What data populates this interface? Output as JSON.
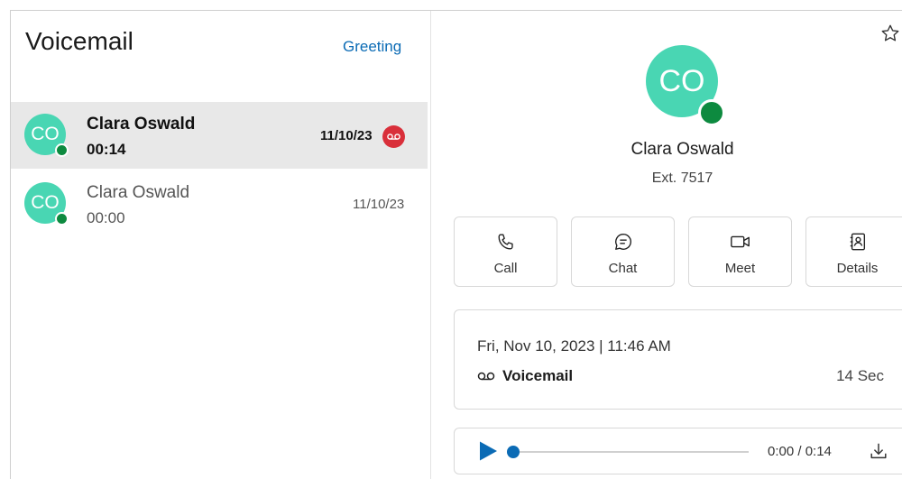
{
  "left": {
    "title": "Voicemail",
    "greeting_label": "Greeting",
    "items": [
      {
        "initials": "CO",
        "name": "Clara Oswald",
        "duration": "00:14",
        "date": "11/10/23",
        "unread": true
      },
      {
        "initials": "CO",
        "name": "Clara Oswald",
        "duration": "00:00",
        "date": "11/10/23",
        "unread": false
      }
    ]
  },
  "contact": {
    "initials": "CO",
    "name": "Clara Oswald",
    "extension": "Ext. 7517",
    "presence": "available"
  },
  "actions": [
    {
      "label": "Call",
      "icon": "phone-icon"
    },
    {
      "label": "Chat",
      "icon": "chat-icon"
    },
    {
      "label": "Meet",
      "icon": "video-icon"
    },
    {
      "label": "Details",
      "icon": "contact-card-icon"
    }
  ],
  "details": {
    "datetime": "Fri, Nov 10, 2023 | 11:46 AM",
    "type_label": "Voicemail",
    "duration_label": "14 Sec"
  },
  "player": {
    "time": "0:00 / 0:14",
    "progress": 0
  },
  "colors": {
    "avatar": "#49d6b3",
    "presence": "#0d8a3f",
    "accent": "#0b6bb5",
    "badge": "#d92f3a",
    "selected_row": "#e8e8e8"
  }
}
